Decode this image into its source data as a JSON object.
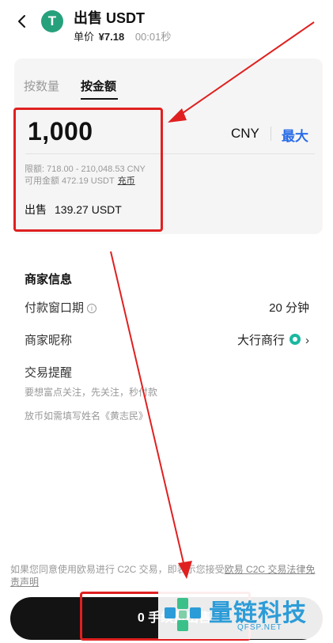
{
  "header": {
    "title": "出售 USDT",
    "coin_symbol": "T",
    "unit_price_label": "单价",
    "unit_price": "¥7.18",
    "timer": "00:01秒"
  },
  "tabs": [
    {
      "label": "按数量",
      "active": false
    },
    {
      "label": "按金额",
      "active": true
    }
  ],
  "amount_panel": {
    "amount": "1,000",
    "currency": "CNY",
    "max_label": "最大",
    "limit_text": "限额: 718.00 - 210,048.53 CNY",
    "available_text": "可用金额 472.19 USDT",
    "recharge_label": "充币",
    "sell_label": "出售",
    "sell_value": "139.27 USDT"
  },
  "merchant": {
    "section_title": "商家信息",
    "payment_window_label": "付款窗口期",
    "payment_window_value": "20 分钟",
    "nickname_label": "商家昵称",
    "nickname_value": "大行商行",
    "reminder_label": "交易提醒",
    "reminder_line1": "要想富点关注，先关注，秒付款",
    "reminder_line2": "放币如需填写姓名《黄志民》"
  },
  "footer": {
    "disclaimer_text": "如果您同意使用欧易进行 C2C 交易，即表示您接受",
    "disclaimer_link": "欧易 C2C 交易法律免责声明",
    "button_label": "0 手续费出售"
  },
  "watermark": {
    "text": "量链科技",
    "sub": "QFSP.NET"
  },
  "colors": {
    "accent_blue": "#2a6ce8",
    "annotation_red": "#e02020",
    "usdt_green": "#26a17b",
    "button_dark": "#131313",
    "watermark_blue": "#2c9cd8"
  },
  "icons": [
    "back-chevron-icon",
    "usdt-coin-icon",
    "info-icon",
    "verified-badge-icon",
    "chevron-right-icon",
    "watermark-logo-icon"
  ]
}
